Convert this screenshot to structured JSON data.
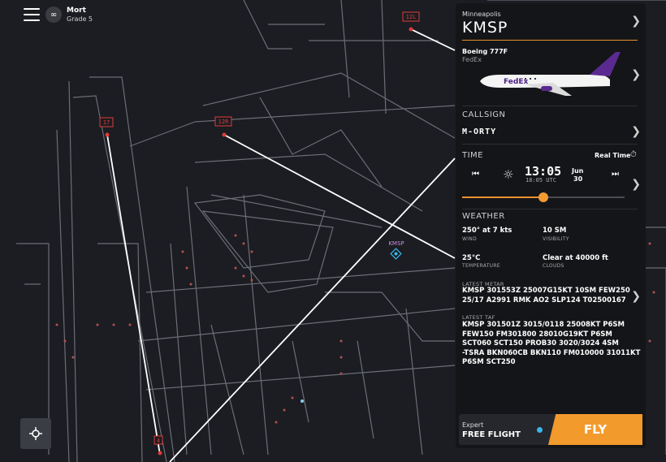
{
  "user": {
    "name": "Mort",
    "grade": "Grade 5"
  },
  "map": {
    "runway_labels": [
      "12L",
      "17",
      "12R",
      "4"
    ],
    "airport_marker": "KMSP"
  },
  "panel": {
    "city": "Minneapolis",
    "code": "KMSP",
    "aircraft": {
      "model": "Boeing 777F",
      "airline": "FedEx",
      "livery_text": "FedEx"
    },
    "callsign": {
      "label": "CALLSIGN",
      "value": "M-ORTY"
    },
    "time": {
      "label": "TIME",
      "realtime_label": "Real Time",
      "local": "13:05",
      "utc": "18:05 UTC",
      "month": "Jun",
      "day": "30",
      "slider_fraction": 0.5
    },
    "weather": {
      "label": "WEATHER",
      "wind": {
        "value": "250° at 7 kts",
        "label": "WIND"
      },
      "visibility": {
        "value": "10 SM",
        "label": "VISIBILITY"
      },
      "temperature": {
        "value": "25°C",
        "label": "TEMPERATURE"
      },
      "clouds": {
        "value": "Clear at 40000 ft",
        "label": "CLOUDS"
      },
      "metar_label": "LATEST METAR",
      "metar": "KMSP 301553Z 25007G15KT 10SM FEW250\n25/17 A2991 RMK AO2 SLP124 T02500167",
      "taf_label": "LATEST TAF",
      "taf": "KMSP 301501Z 3015/0118 25008KT P6SM\nFEW150 FM301800 28010G19KT P6SM\nSCT060 SCT150 PROB30 3020/3024 4SM\n-TSRA BKN060CB BKN110 FM010000 31011KT\nP6SM SCT250"
    },
    "mode": {
      "label": "Expert",
      "value": "FREE FLIGHT"
    },
    "fly_label": "FLY"
  },
  "colors": {
    "accent": "#f39a2c",
    "runway_label": "#e03a3a",
    "marker": "#3bb7e7"
  }
}
